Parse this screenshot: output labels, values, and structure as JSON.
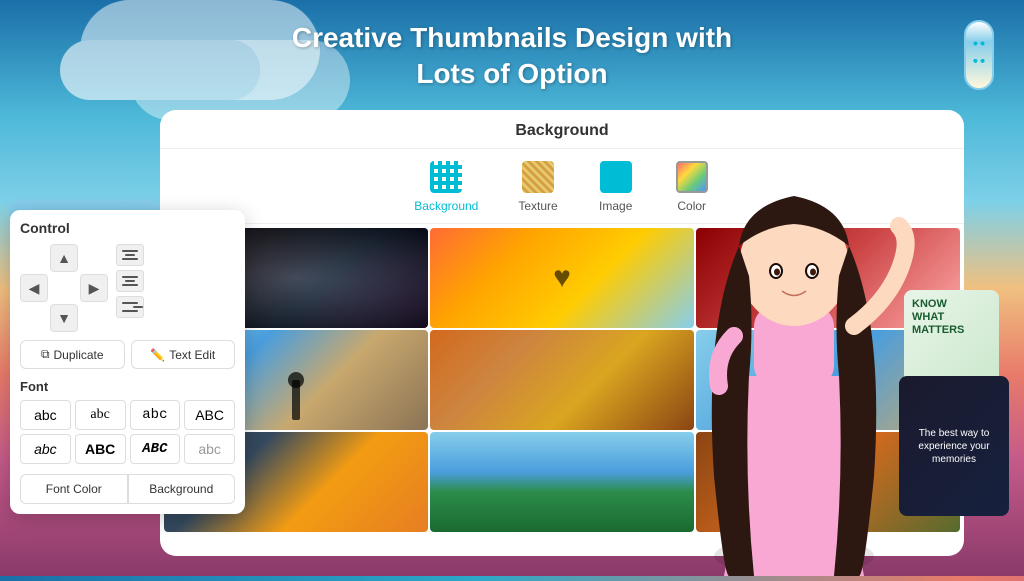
{
  "app": {
    "title_line1": "Creative Thumbnails Design with",
    "title_line2": "Lots of Option"
  },
  "card": {
    "header": "Background"
  },
  "tabs": [
    {
      "id": "background",
      "label": "Background",
      "active": true
    },
    {
      "id": "texture",
      "label": "Texture",
      "active": false
    },
    {
      "id": "image",
      "label": "Image",
      "active": false
    },
    {
      "id": "color",
      "label": "Color",
      "active": false
    }
  ],
  "control": {
    "title": "Control",
    "arrows": {
      "up": "▲",
      "left": "◀",
      "right": "▶",
      "down": "▼"
    },
    "buttons": {
      "duplicate": "Duplicate",
      "text_edit": "Text Edit"
    }
  },
  "font": {
    "section_label": "Font",
    "samples": [
      {
        "id": "sans1",
        "text": "abc",
        "style": "sans"
      },
      {
        "id": "serif1",
        "text": "abc",
        "style": "serif"
      },
      {
        "id": "mono1",
        "text": "abc",
        "style": "mono"
      },
      {
        "id": "caps1",
        "text": "ABC",
        "style": "caps"
      },
      {
        "id": "italic1",
        "text": "abc",
        "style": "italic"
      },
      {
        "id": "bold1",
        "text": "ABC",
        "style": "bold"
      },
      {
        "id": "bolditalic1",
        "text": "ABC",
        "style": "bold-italic"
      },
      {
        "id": "thin1",
        "text": "abc",
        "style": "thin"
      }
    ]
  },
  "color_tabs": [
    {
      "id": "font-color",
      "label": "Font Color"
    },
    {
      "id": "background-color",
      "label": "Background"
    }
  ],
  "floating_card_1": {
    "text": "The best way to experience your memories"
  },
  "floating_card_2": {
    "line1": "KNOW",
    "line2": "WHAT",
    "line3": "MATTERS"
  }
}
